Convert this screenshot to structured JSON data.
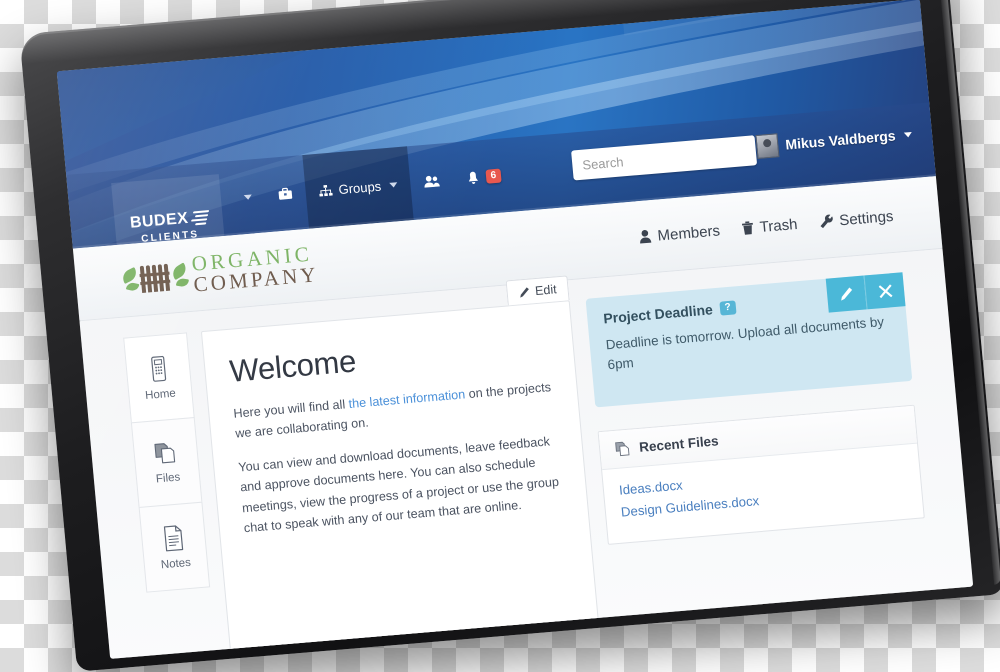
{
  "brand": {
    "name": "BUDEX",
    "sub": "CLIENTS",
    "logo_icon": "wing-icon"
  },
  "navbar": {
    "items": [
      {
        "label": "",
        "icon": "chevron-down-icon",
        "active": false
      },
      {
        "label": "",
        "icon": "briefcase-icon",
        "active": false
      },
      {
        "label": "Groups",
        "icon": "sitemap-icon",
        "active": true,
        "caret": true
      },
      {
        "label": "",
        "icon": "people-icon",
        "active": false
      },
      {
        "label": "",
        "icon": "bell-icon",
        "active": false,
        "badge": "6"
      }
    ],
    "notification_count": "6"
  },
  "search": {
    "placeholder": "Search",
    "value": "",
    "icon": "search-icon"
  },
  "user": {
    "name": "Mikus Valdbergs",
    "avatar_icon": "avatar-icon",
    "caret_icon": "chevron-down-icon"
  },
  "group": {
    "logo_line1": "ORGANIC",
    "logo_line2": "COMPANY",
    "logo_icon": "fence-leaves-icon",
    "actions": [
      {
        "label": "Members",
        "icon": "person-icon"
      },
      {
        "label": "Trash",
        "icon": "trash-icon"
      },
      {
        "label": "Settings",
        "icon": "wrench-icon"
      }
    ]
  },
  "sidebar": {
    "items": [
      {
        "label": "Home",
        "icon": "home-icon",
        "selected": true
      },
      {
        "label": "Files",
        "icon": "files-icon",
        "selected": false
      },
      {
        "label": "Notes",
        "icon": "notes-icon",
        "selected": false
      }
    ]
  },
  "welcome_card": {
    "edit_label": "Edit",
    "edit_icon": "pencil-icon",
    "title": "Welcome",
    "para1_before": "Here you will find all ",
    "para1_link": "the latest information",
    "para1_after": " on the projects we are collaborating on.",
    "para2": "You can view and download documents, leave feedback and approve documents here. You can also schedule meetings, view the progress of a project or use the group chat to speak with any of our team that are online."
  },
  "notice": {
    "title": "Project Deadline",
    "badge": "?",
    "body": "Deadline is tomorrow. Upload all documents by 6pm",
    "edit_icon": "pencil-icon",
    "close_icon": "close-icon",
    "bg_color": "#cfe7f2",
    "button_color": "#4bb8d8"
  },
  "recent_files": {
    "title": "Recent Files",
    "icon": "copy-files-icon",
    "files": [
      {
        "name": "Ideas.docx"
      },
      {
        "name": "Design Guidelines.docx"
      }
    ]
  },
  "colors": {
    "header_blue": "#1f5aa6",
    "accent_teal": "#4bb8d8",
    "link_blue": "#4a90d9",
    "badge_red": "#e8584f",
    "green": "#7ab262",
    "brown": "#6b5749"
  }
}
